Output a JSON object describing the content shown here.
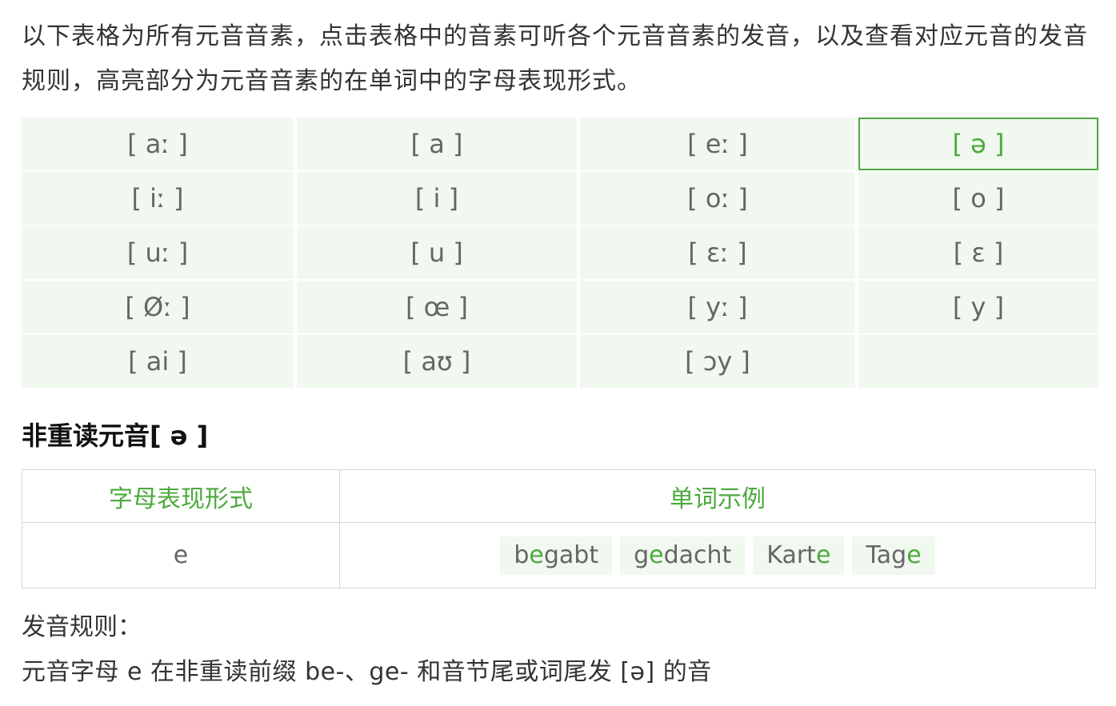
{
  "intro": "以下表格为所有元音音素，点击表格中的音素可听各个元音音素的发音，以及查看对应元音的发音规则，高亮部分为元音音素的在单词中的字母表现形式。",
  "vowels": [
    "[ aː ]",
    "[ a ]",
    "[ eː ]",
    "[ ə ]",
    "[ iː ]",
    "[ i ]",
    "[ oː ]",
    "[ o ]",
    "[ uː ]",
    "[ u ]",
    "[ ɛː ]",
    "[ ɛ ]",
    "[ Øː ]",
    "[ œ ]",
    "[ yː ]",
    "[ y ]",
    "[ ai ]",
    "[ aʊ ]",
    "[ ɔy ]",
    ""
  ],
  "active_vowel": "[ ə ]",
  "section_title": "非重读元音[ ə ]",
  "detail_table": {
    "headers": [
      "字母表现形式",
      "单词示例"
    ],
    "letter_form": "e",
    "examples": [
      {
        "pre": "b",
        "hl": "e",
        "post": "gabt"
      },
      {
        "pre": "g",
        "hl": "e",
        "post": "dacht"
      },
      {
        "pre": "Kart",
        "hl": "e",
        "post": ""
      },
      {
        "pre": "Tag",
        "hl": "e",
        "post": ""
      }
    ]
  },
  "rule_label": "发音规则：",
  "rule_text": "元音字母 e 在非重读前缀 be-、ge- 和音节尾或词尾发 [ə] 的音",
  "colors": {
    "accent": "#4caa3d",
    "cell_bg": "#f1f8f0",
    "text": "#333333",
    "muted": "#666666",
    "border": "#d6d6d6"
  }
}
